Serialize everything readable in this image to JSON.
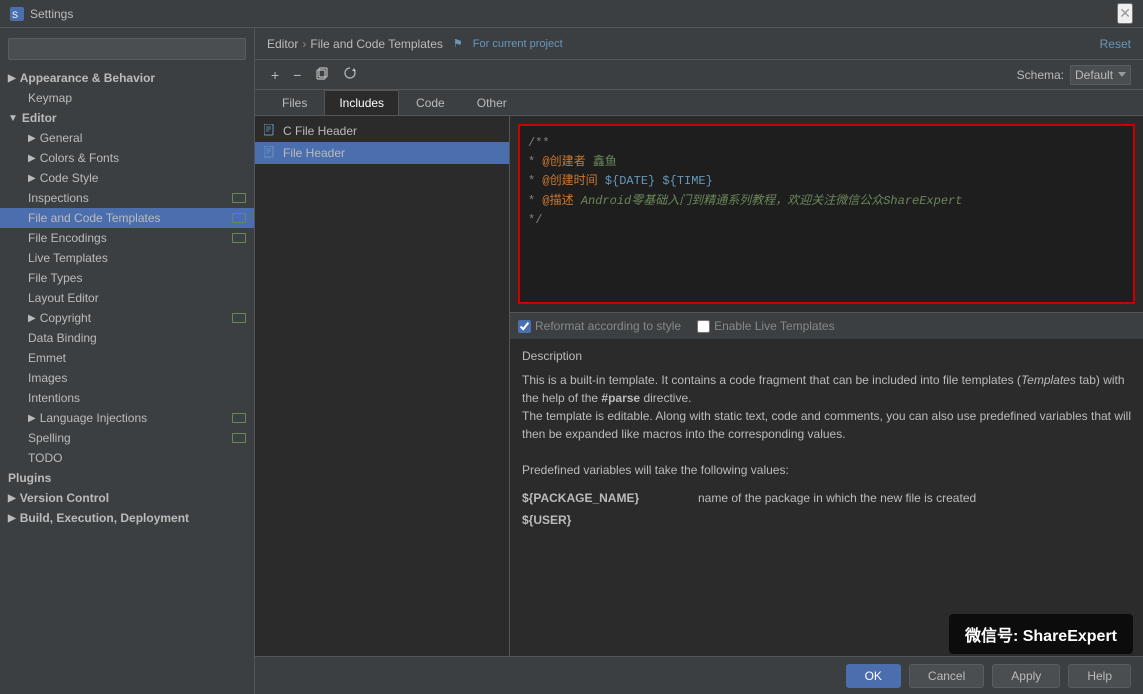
{
  "titleBar": {
    "title": "Settings",
    "closeLabel": "✕"
  },
  "search": {
    "placeholder": ""
  },
  "sidebar": {
    "sections": [
      {
        "id": "appearance",
        "label": "Appearance & Behavior",
        "expanded": false,
        "level": 0
      },
      {
        "id": "keymap",
        "label": "Keymap",
        "expanded": false,
        "level": 1
      },
      {
        "id": "editor",
        "label": "Editor",
        "expanded": true,
        "level": 0
      },
      {
        "id": "general",
        "label": "General",
        "expanded": false,
        "level": 1,
        "arrow": true
      },
      {
        "id": "colors-fonts",
        "label": "Colors & Fonts",
        "expanded": false,
        "level": 1,
        "arrow": true
      },
      {
        "id": "code-style",
        "label": "Code Style",
        "expanded": false,
        "level": 1,
        "arrow": true
      },
      {
        "id": "inspections",
        "label": "Inspections",
        "expanded": false,
        "level": 1,
        "badge": true
      },
      {
        "id": "file-and-code-templates",
        "label": "File and Code Templates",
        "expanded": false,
        "level": 1,
        "active": true,
        "badge": true
      },
      {
        "id": "file-encodings",
        "label": "File Encodings",
        "expanded": false,
        "level": 1,
        "badge": true
      },
      {
        "id": "live-templates",
        "label": "Live Templates",
        "expanded": false,
        "level": 1
      },
      {
        "id": "file-types",
        "label": "File Types",
        "expanded": false,
        "level": 1
      },
      {
        "id": "layout-editor",
        "label": "Layout Editor",
        "expanded": false,
        "level": 1
      },
      {
        "id": "copyright",
        "label": "Copyright",
        "expanded": false,
        "level": 1,
        "arrow": true,
        "badge": true
      },
      {
        "id": "data-binding",
        "label": "Data Binding",
        "expanded": false,
        "level": 1
      },
      {
        "id": "emmet",
        "label": "Emmet",
        "expanded": false,
        "level": 1
      },
      {
        "id": "images",
        "label": "Images",
        "expanded": false,
        "level": 1
      },
      {
        "id": "intentions",
        "label": "Intentions",
        "expanded": false,
        "level": 1
      },
      {
        "id": "language-injections",
        "label": "Language Injections",
        "expanded": false,
        "level": 1,
        "arrow": true,
        "badge": true
      },
      {
        "id": "spelling",
        "label": "Spelling",
        "expanded": false,
        "level": 1,
        "badge": true
      },
      {
        "id": "todo",
        "label": "TODO",
        "expanded": false,
        "level": 1
      }
    ],
    "bottomSections": [
      {
        "id": "plugins",
        "label": "Plugins",
        "level": 0
      },
      {
        "id": "version-control",
        "label": "Version Control",
        "level": 0,
        "arrow": true
      },
      {
        "id": "build-execution",
        "label": "Build, Execution, Deployment",
        "level": 0,
        "arrow": true
      }
    ]
  },
  "header": {
    "breadcrumb": {
      "parts": [
        "Editor",
        "File and Code Templates"
      ],
      "separator": "›",
      "projectNote": "⚑ For current project"
    },
    "resetLabel": "Reset"
  },
  "toolbar": {
    "addLabel": "+",
    "removeLabel": "−",
    "copyLabel": "⊡",
    "resetLabel": "↺",
    "schemaLabel": "Schema:",
    "schemaOptions": [
      "Default"
    ],
    "schemaSelected": "Default"
  },
  "tabs": [
    {
      "id": "files",
      "label": "Files"
    },
    {
      "id": "includes",
      "label": "Includes",
      "active": true
    },
    {
      "id": "code",
      "label": "Code"
    },
    {
      "id": "other",
      "label": "Other"
    }
  ],
  "fileList": [
    {
      "id": "c-file-header",
      "label": "C File Header",
      "icon": "template"
    },
    {
      "id": "file-header",
      "label": "File Header",
      "icon": "template",
      "selected": true
    }
  ],
  "editor": {
    "lines": [
      {
        "type": "comment",
        "text": "/**"
      },
      {
        "type": "code",
        "prefix": " * ",
        "label": "@创建者",
        "space": "   ",
        "value": "鑫鱼"
      },
      {
        "type": "code",
        "prefix": " * ",
        "label": "@创建时间",
        "space": " ",
        "value": "${DATE}  ${TIME}"
      },
      {
        "type": "code",
        "prefix": " * ",
        "label": "@描述",
        "space": "    ",
        "value": "Android零基础入门到精通系列教程，欢迎关注微信公众ShareExpert"
      },
      {
        "type": "comment",
        "text": " */"
      }
    ]
  },
  "options": {
    "reformatLabel": "Reformat according to style",
    "enableLiveTemplatesLabel": "Enable Live Templates"
  },
  "description": {
    "title": "Description",
    "text": "This is a built-in template. It contains a code fragment that can be included into file templates (Templates tab) with the help of the #parse directive.\nThe template is editable. Along with static text, code and comments, you can also use predefined variables that will then be expanded like macros into the corresponding values.\n\nPredefined variables will take the following values:",
    "variables": [
      {
        "name": "${PACKAGE_NAME}",
        "desc": "name of the package in which the new file is created"
      },
      {
        "name": "${USER}",
        "desc": ""
      }
    ]
  },
  "footer": {
    "okLabel": "OK",
    "cancelLabel": "Cancel",
    "applyLabel": "Apply",
    "helpLabel": "Help"
  },
  "watermark": "微信号: ShareExpert"
}
